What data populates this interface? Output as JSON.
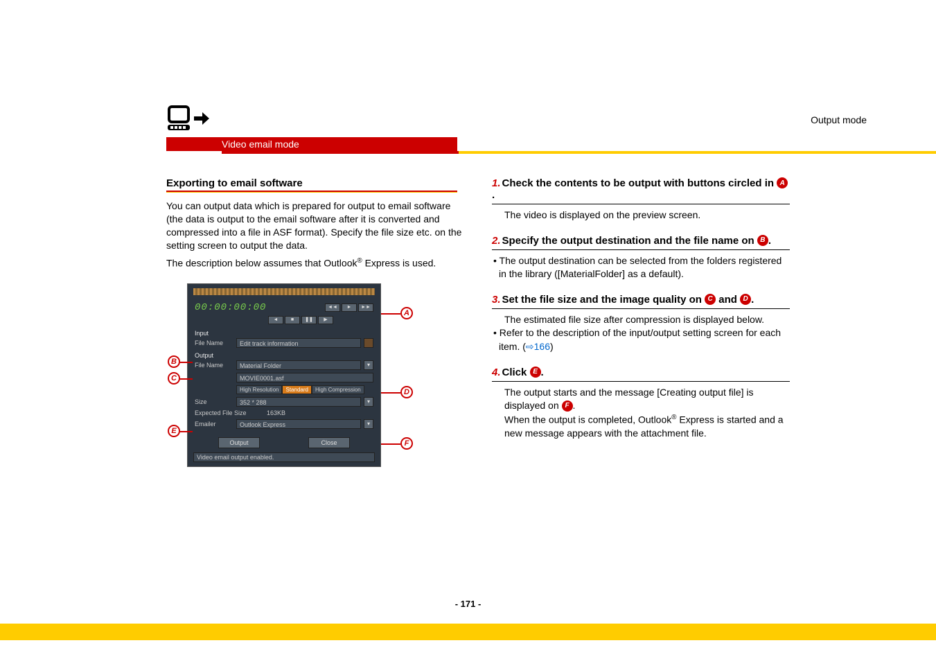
{
  "header": {
    "mode_label": "Output mode",
    "bar_label": "Video email mode"
  },
  "left": {
    "heading": "Exporting to email software",
    "para1": "You can output data which is prepared for output to email software (the data is output to the email software after it is converted and compressed into a file in ASF format). Specify the file size etc. on the setting screen to output the data.",
    "para2a": "The description below assumes that Outlook",
    "para2b": " Express is used."
  },
  "screenshot": {
    "timer": "00:00:00:00",
    "input_label": "Input",
    "input_filename_label": "File Name",
    "input_filename_value": "Edit track information",
    "output_label": "Output",
    "output_filename_label": "File Name",
    "output_folder_value": "Material Folder",
    "output_file_value": "MOVIE0001.asf",
    "tab_high_res": "High Resolution",
    "tab_standard": "Standard",
    "tab_high_comp": "High Compression",
    "size_label": "Size",
    "size_value": "352 * 288",
    "expected_label": "Expected File Size",
    "expected_value": "163KB",
    "emailer_label": "Emailer",
    "emailer_value": "Outlook Express",
    "output_btn": "Output",
    "close_btn": "Close",
    "status": "Video email output enabled."
  },
  "callouts": {
    "a": "A",
    "b": "B",
    "c": "C",
    "d": "D",
    "e": "E",
    "f": "F"
  },
  "steps": {
    "s1": {
      "num": "1.",
      "head_a": "Check the contents to be output with buttons circled in ",
      "head_b": ".",
      "body": "The video is displayed on the preview screen."
    },
    "s2": {
      "num": "2.",
      "head_a": "Specify the output destination and the file name on ",
      "head_b": ".",
      "bullet": "• The output destination can be selected from the folders registered in the library ([MaterialFolder] as a default)."
    },
    "s3": {
      "num": "3.",
      "head_a": "Set the file size and the image quality on ",
      "head_mid": " and ",
      "head_b": ".",
      "body1": "The estimated file size after compression is displayed below.",
      "bullet_a": "• Refer to the description of the input/output setting screen for each item. (",
      "link_arrow": "⇨",
      "link_num": "166",
      "bullet_b": ")"
    },
    "s4": {
      "num": "4.",
      "head_a": "Click ",
      "head_b": ".",
      "body1a": "The output starts and the message [Creating output file] is displayed on ",
      "body1b": ".",
      "body2a": "When the output is completed, Outlook",
      "body2b": " Express is started and a new message appears with the attachment file."
    }
  },
  "page_number": "- 171 -"
}
